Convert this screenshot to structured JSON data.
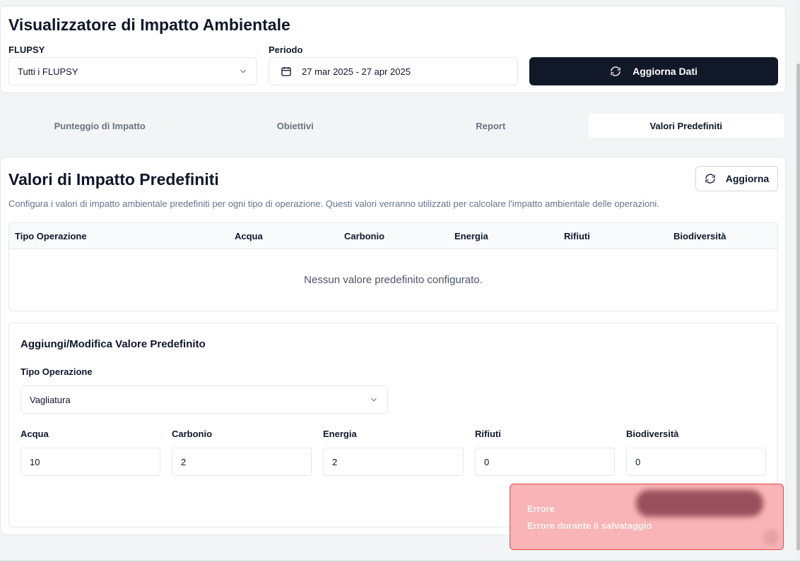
{
  "header": {
    "title": "Visualizzatore di Impatto Ambientale",
    "flupsy_label": "FLUPSY",
    "flupsy_value": "Tutti i FLUPSY",
    "period_label": "Periodo",
    "period_value": "27 mar 2025 - 27 apr 2025",
    "update_button": "Aggiorna Dati"
  },
  "tabs": [
    {
      "label": "Punteggio di Impatto",
      "active": false
    },
    {
      "label": "Obiettivi",
      "active": false
    },
    {
      "label": "Report",
      "active": false
    },
    {
      "label": "Valori Predefiniti",
      "active": true
    }
  ],
  "section": {
    "title": "Valori di Impatto Predefiniti",
    "refresh_button": "Aggiorna",
    "description": "Configura i valori di impatto ambientale predefiniti per ogni tipo di operazione. Questi valori verranno utilizzati per calcolare l'impatto ambientale delle operazioni."
  },
  "table": {
    "columns": [
      "Tipo Operazione",
      "Acqua",
      "Carbonio",
      "Energia",
      "Rifiuti",
      "Biodiversità"
    ],
    "empty_message": "Nessun valore predefinito configurato."
  },
  "form": {
    "title": "Aggiungi/Modifica Valore Predefinito",
    "operation_label": "Tipo Operazione",
    "operation_value": "Vagliatura",
    "fields": [
      {
        "label": "Acqua",
        "value": "10"
      },
      {
        "label": "Carbonio",
        "value": "2"
      },
      {
        "label": "Energia",
        "value": "2"
      },
      {
        "label": "Rifiuti",
        "value": "0"
      },
      {
        "label": "Biodiversità",
        "value": "0"
      }
    ]
  },
  "toast": {
    "title": "Errore",
    "message": "Errore durante il salvataggio"
  },
  "colors": {
    "primary": "#111827",
    "toast_bg": "#f8b4b6",
    "toast_border": "#ef4444"
  }
}
